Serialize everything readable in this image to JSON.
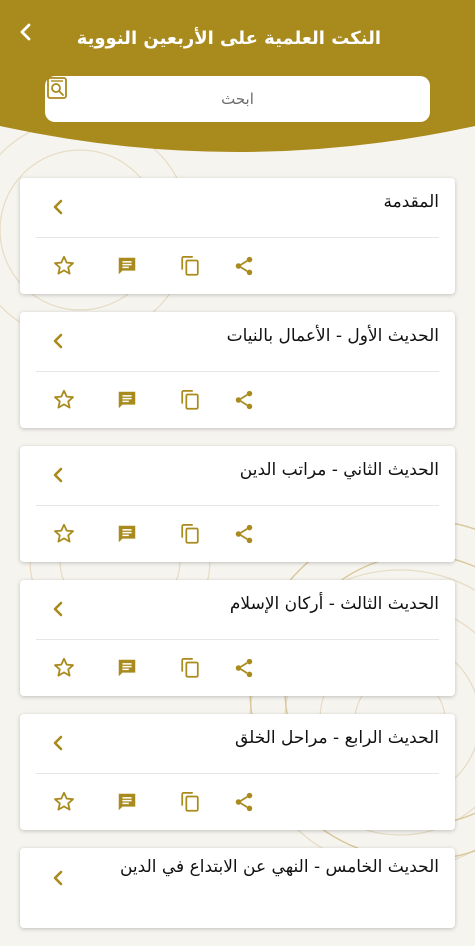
{
  "header": {
    "title": "النكت العلمية على الأربعين النووية",
    "back_icon": "chevron-left-icon"
  },
  "search": {
    "placeholder": "ابحث",
    "icon": "search-icon"
  },
  "theme": {
    "primary": "#a98a1c",
    "icon_color": "#a98a1c",
    "background": "#f6f4ef"
  },
  "items": [
    {
      "title": "المقدمة"
    },
    {
      "title": "الحديث الأول - الأعمال بالنيات"
    },
    {
      "title": "الحديث الثاني - مراتب الدين"
    },
    {
      "title": "الحديث الثالث - أركان الإسلام"
    },
    {
      "title": "الحديث الرابع - مراحل الخلق"
    },
    {
      "title": "الحديث الخامس - النهي عن الابتداع في الدين"
    }
  ],
  "card_actions": [
    "favorite-star-icon",
    "notes-icon",
    "copy-icon",
    "share-icon"
  ]
}
